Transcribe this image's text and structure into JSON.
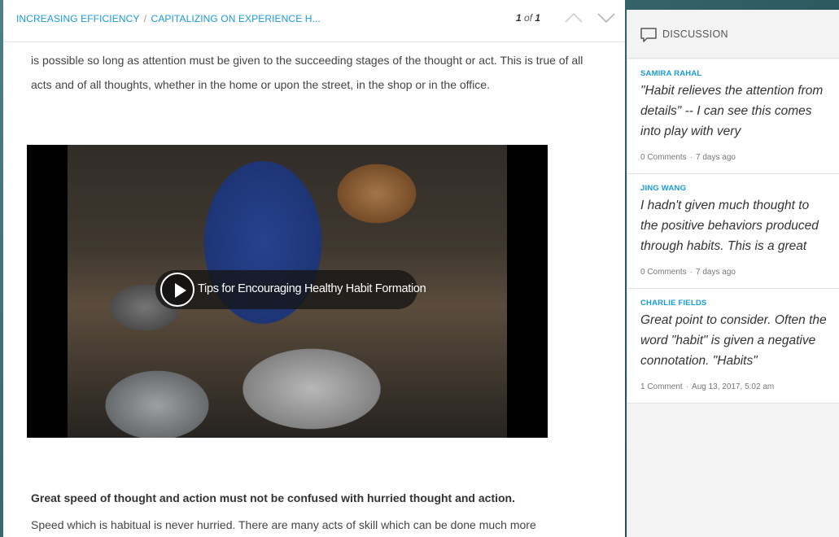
{
  "breadcrumb": {
    "part1": "INCREASING EFFICIENCY",
    "separator": "/",
    "part2": "CAPITALIZING ON EXPERIENCE H..."
  },
  "pager": {
    "current": "1",
    "of_label": "of",
    "total": "1"
  },
  "article": {
    "para1": "is possible so long as attention must be given to the succeeding stages of the thought or act. This is true of all acts and of all thoughts, whether in the home or upon the street, in the shop or in the office.",
    "video_title": "Tips for Encouraging Healthy Habit Formation",
    "bold_heading": "Great speed of thought and action must not be confused with hurried thought and action.",
    "para2": "Speed which is habitual is never hurried. There are many acts of skill which can be done much more"
  },
  "sidebar": {
    "title": "DISCUSSION",
    "posts": [
      {
        "author": "SAMIRA RAHAL",
        "text": "\"Habit relieves the attention from details\" -- I can see this comes into play with very",
        "comments": "0 Comments",
        "time": "7 days ago"
      },
      {
        "author": "JING WANG",
        "text": "I hadn't given much thought to the positive behaviors produced through habits. This is a great",
        "comments": "0 Comments",
        "time": "7 days ago"
      },
      {
        "author": "CHARLIE FIELDS",
        "text": "Great point to consider. Often the word \"habit\" is given a negative connotation. \"Habits\"",
        "comments": "1 Comment",
        "time": "Aug 13, 2017, 5:02 am"
      }
    ]
  },
  "colors": {
    "accent": "#1a9bd7",
    "sidebar_bg": "#f3f3f3",
    "backdrop": "#3d6e74"
  },
  "icons": {
    "prev": "chevron-up-icon",
    "next": "chevron-down-icon",
    "discussion": "speech-bubble-icon",
    "play": "play-icon"
  }
}
